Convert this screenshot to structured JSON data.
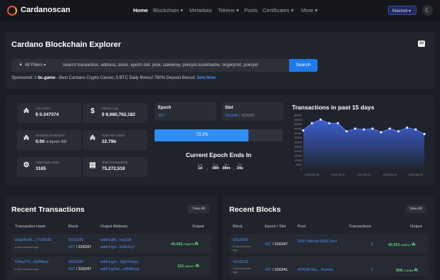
{
  "nav": {
    "logo": "Cardanoscan",
    "items": [
      "Home",
      "Blockchain",
      "Metadata",
      "Tokens",
      "Pools",
      "Certificates",
      "More"
    ],
    "network": "Mainnet"
  },
  "hero": {
    "title": "Cardano Blockchain Explorer",
    "ad_badge": "Ad",
    "filter_label": "All Filters",
    "search_placeholder": "Search transaction, address, block, epoch.slot, pool, stakeKey, policyId.assetName, fingerprint, policyId",
    "search_button": "Search",
    "sponsored_label": "Sponsored:",
    "sponsor_name": "bc.game",
    "sponsor_text": "- Best Cardano Crypto Casino, 5 BTC Daily Bonus! 760% Deposit Bonus!",
    "sponsor_link": "Join Now"
  },
  "stats": {
    "ada_price_label": "ADA Price",
    "ada_price": "$ 0.247374",
    "market_cap_label": "Market Cap",
    "market_cap": "$ 8,680,762,182",
    "rewards_label": "Rewards Distributed",
    "rewards_value": "0.00",
    "rewards_epoch": "in Epoch 435",
    "total_stake_label": "Total ADA Stake",
    "total_stake": "22.79b",
    "stake_pools_label": "Total stake pools",
    "stake_pools": "3165",
    "total_tx_label": "Total Transactions",
    "total_tx": "75,272,518"
  },
  "epoch": {
    "epoch_label": "Epoch",
    "epoch_value": "437",
    "slot_label": "Slot",
    "slot_value": "316246",
    "slot_total": "/ 432000",
    "progress_text": "73.2%",
    "progress": 0.732,
    "ends_title": "Current Epoch Ends In",
    "countdown": [
      {
        "label": "Day",
        "value": "1d"
      },
      {
        "label": "Hour",
        "value": "08h"
      },
      {
        "label": "Min",
        "value": "08m"
      },
      {
        "label": "Sec",
        "value": "34s"
      }
    ]
  },
  "chart_data": {
    "type": "area",
    "title": "Transactions in past 15 days",
    "x_tick_labels": [
      "2023-08-08",
      "2023-08-10",
      "2023-08-12",
      "2023-08-14",
      "2023-08-16"
    ],
    "values": [
      43000,
      51000,
      55000,
      51000,
      51000,
      42000,
      45000,
      44000,
      45000,
      41000,
      45000,
      42000,
      46000,
      44000,
      39000
    ],
    "ylim": [
      0,
      60000
    ],
    "y_tick_labels": [
      "0",
      "5000",
      "10000",
      "15000",
      "20000",
      "25000",
      "30000",
      "35000",
      "40000",
      "45000",
      "50000",
      "55000",
      "60000"
    ],
    "color": "#3d63d8"
  },
  "recent_tx": {
    "title": "Recent Transactions",
    "view_all": "View All",
    "headers": [
      "Transaction Hash",
      "Block",
      "Output Address",
      "Output"
    ],
    "rows": [
      {
        "hash": "e53a4cd0...77d2f182",
        "time": "a few seconds ago",
        "block": "9318330",
        "epoch": "437",
        "slot": "316247",
        "addr1": "addr1q8t...fxcj2jdt",
        "addr2": "addr1qyx...kz8v9cj7",
        "output": "40,662.",
        "output_dec": "938575"
      },
      {
        "hash": "f1f4a276...f0d9fba2",
        "time": "a few seconds ago",
        "block": "9318330",
        "epoch": "437",
        "slot": "316247",
        "addr1": "addr1qyh...9gh7m6pa",
        "addr2": "addr1qy5w...ss8d6nyp",
        "output": "152.",
        "output_dec": "426467"
      }
    ]
  },
  "recent_blocks": {
    "title": "Recent Blocks",
    "view_all": "View All",
    "headers": [
      "Block",
      "Epoch / Slot",
      "Pool",
      "Transactions",
      "Output"
    ],
    "rows": [
      {
        "block": "9318330",
        "time": "a few seconds ago",
        "epoch": "437",
        "slot": "316247",
        "pool": "RAP-Nekota ADA Pool",
        "tx": "3",
        "output": "40,921.",
        "output_dec": "363612"
      },
      {
        "block": "9318329",
        "time": "a few seconds ago",
        "epoch": "437",
        "slot": "316241",
        "pool": "ATADA Sta... Austria",
        "tx": "3",
        "output": "908.",
        "output_dec": "714463"
      }
    ]
  }
}
